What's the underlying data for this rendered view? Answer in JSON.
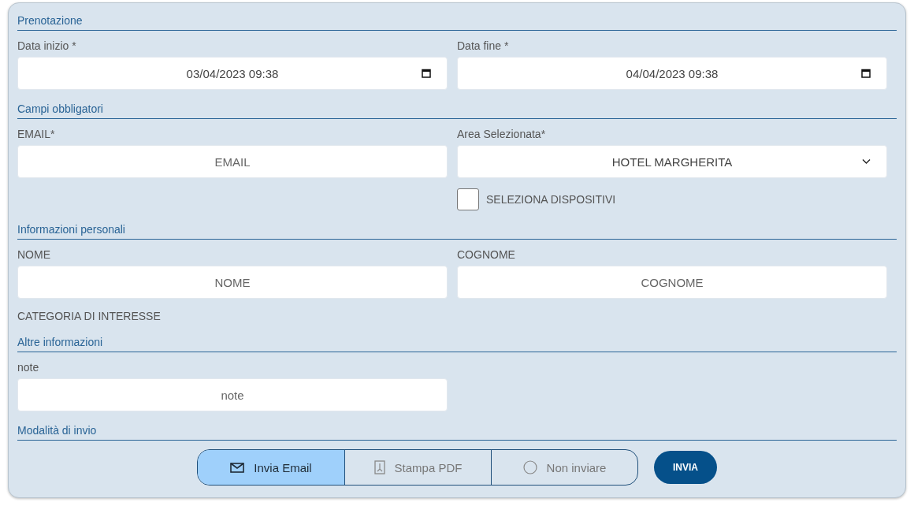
{
  "sections": [
    {
      "title": "Prenotazione",
      "rows": [
        {
          "left": {
            "kind": "date",
            "label": "Data inizio *",
            "value": "03/04/2023 09:38"
          },
          "right": {
            "kind": "date",
            "label": "Data fine *",
            "value": "04/04/2023 09:38"
          }
        }
      ]
    },
    {
      "title": "Campi obbligatori",
      "rows": [
        {
          "left": {
            "kind": "text",
            "label": "EMAIL*",
            "placeholder": "EMAIL"
          },
          "right": {
            "kind": "select",
            "label": "Area Selezionata*",
            "value": "HOTEL MARGHERITA"
          }
        },
        {
          "right": {
            "kind": "checkbox",
            "label": "SELEZIONA DISPOSITIVI",
            "checked": false
          }
        }
      ]
    },
    {
      "title": "Informazioni personali",
      "rows": [
        {
          "left": {
            "kind": "text",
            "label": "NOME",
            "placeholder": "NOME"
          },
          "right": {
            "kind": "text",
            "label": "COGNOME",
            "placeholder": "COGNOME"
          }
        },
        {
          "left": {
            "kind": "caption",
            "label": "CATEGORIA DI INTERESSE"
          }
        }
      ]
    },
    {
      "title": "Altre informazioni",
      "rows": [
        {
          "left": {
            "kind": "text",
            "label": "note",
            "placeholder": "note"
          }
        }
      ]
    },
    {
      "title": "Modalità di invio"
    }
  ],
  "send_modes": [
    {
      "kind": "email",
      "label": "Invia Email",
      "selected": true
    },
    {
      "kind": "pdf",
      "label": "Stampa PDF",
      "selected": false
    },
    {
      "kind": "none",
      "label": "Non inviare",
      "selected": false
    }
  ],
  "submit": "INVIA"
}
